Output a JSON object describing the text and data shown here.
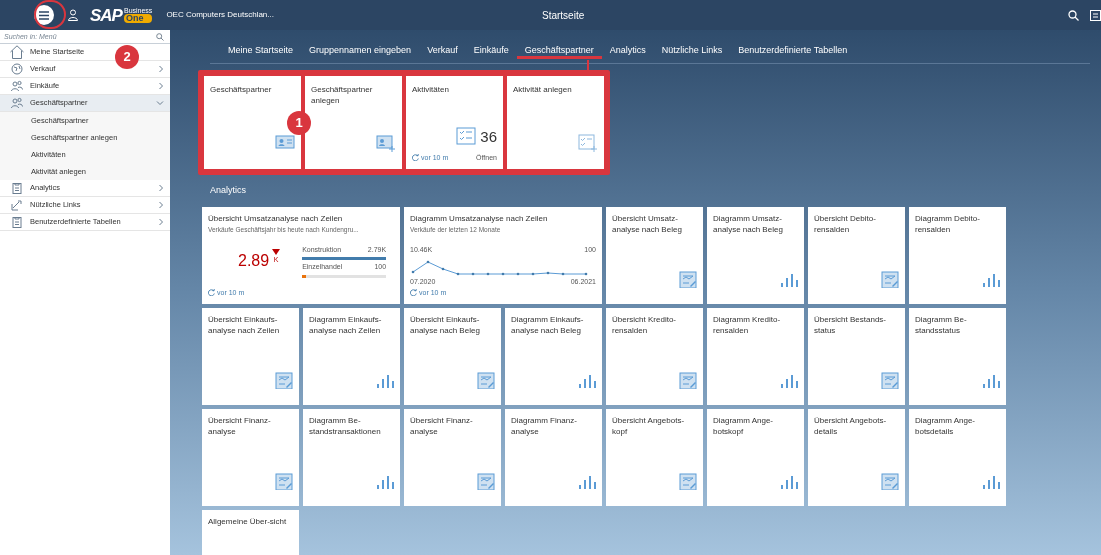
{
  "header": {
    "title": "Startseite",
    "company": "OEC Computers Deutschlan...",
    "logo": "SAP",
    "logo_sub": [
      "Business",
      "One"
    ]
  },
  "sidebar": {
    "search": {
      "placeholder": "Suchen in: Menü"
    },
    "items": [
      {
        "label": "Meine Startseite",
        "kind": "home",
        "expandable": false,
        "expanded": false
      },
      {
        "label": "Verkauf",
        "kind": "sales",
        "expandable": true,
        "expanded": false
      },
      {
        "label": "Einkäufe",
        "kind": "people",
        "expandable": true,
        "expanded": false
      },
      {
        "label": "Geschäftspartner",
        "kind": "people",
        "expandable": true,
        "expanded": true,
        "children": [
          {
            "label": "Geschäftspartner"
          },
          {
            "label": "Geschäftspartner anlegen"
          },
          {
            "label": "Aktivitäten"
          },
          {
            "label": "Aktivität anlegen"
          }
        ]
      },
      {
        "label": "Analytics",
        "kind": "clipboard",
        "expandable": true,
        "expanded": false
      },
      {
        "label": "Nützliche Links",
        "kind": "links",
        "expandable": true,
        "expanded": false
      },
      {
        "label": "Benutzerdefinierte Tabellen",
        "kind": "clipboard",
        "expandable": true,
        "expanded": false
      }
    ]
  },
  "tabs": [
    {
      "label": "Meine Startseite",
      "selected": false
    },
    {
      "label": "Gruppennamen eingeben",
      "selected": false
    },
    {
      "label": "Verkauf",
      "selected": false
    },
    {
      "label": "Einkäufe",
      "selected": false
    },
    {
      "label": "Geschäftspartner",
      "selected": true
    },
    {
      "label": "Analytics",
      "selected": false
    },
    {
      "label": "Nützliche Links",
      "selected": false
    },
    {
      "label": "Benutzerdefinierte Tabellen",
      "selected": false
    }
  ],
  "group_tiles": [
    {
      "kind": "card",
      "title": "Geschäftspartner"
    },
    {
      "kind": "card-add",
      "title": "Geschäftspartner anlegen"
    },
    {
      "kind": "count",
      "title": "Aktivitäten",
      "count": "36",
      "refresh": "vor 10 m",
      "action": "Öffnen"
    },
    {
      "kind": "task-add",
      "title": "Aktivität anlegen"
    }
  ],
  "analytics": {
    "title": "Analytics",
    "tiles": [
      {
        "kind": "kpi",
        "title": "Übersicht Umsatzanalyse nach Zeilen",
        "subtitle": "Verkäufe Geschäftsjahr bis heute nach Kundengru...",
        "value": "2.89",
        "unit": "K",
        "bars": [
          {
            "label": "Konstruktion",
            "value": "2.79K",
            "level": 1.0,
            "color": "#427cac"
          },
          {
            "label": "Einzelhandel",
            "value": "100",
            "level": 0.04,
            "color": "#e9730c"
          }
        ],
        "refresh": "vor 10 m"
      },
      {
        "kind": "trend",
        "title": "Diagramm Umsatzanalyse nach Zeilen",
        "subtitle": "Verkäufe der letzten 12 Monate",
        "max_label": "10.46K",
        "min_label": "100",
        "start_label": "07.2020",
        "end_label": "06.2021",
        "refresh": "vor 10 m"
      },
      {
        "kind": "report",
        "title": "Übersicht Umsatz-analyse nach Beleg"
      },
      {
        "kind": "chart",
        "title": "Diagramm Umsatz-analyse nach Beleg"
      },
      {
        "kind": "report",
        "title": "Übersicht Debito-rensalden"
      },
      {
        "kind": "chart",
        "title": "Diagramm Debito-rensalden"
      },
      {
        "kind": "report",
        "title": "Übersicht Einkaufs-analyse nach Zeilen"
      },
      {
        "kind": "chart",
        "title": "Diagramm Einkaufs-analyse nach Zeilen"
      },
      {
        "kind": "report",
        "title": "Übersicht Einkaufs-analyse nach Beleg"
      },
      {
        "kind": "chart",
        "title": "Diagramm Einkaufs-analyse nach Beleg"
      },
      {
        "kind": "report",
        "title": "Übersicht Kredito-rensalden"
      },
      {
        "kind": "chart",
        "title": "Diagramm Kredito-rensalden"
      },
      {
        "kind": "report",
        "title": "Übersicht Bestands-status"
      },
      {
        "kind": "chart",
        "title": "Diagramm Be-standsstatus"
      },
      {
        "kind": "report",
        "title": "Übersicht Finanz-analyse"
      },
      {
        "kind": "chart",
        "title": "Diagramm Be-standstransaktionen"
      },
      {
        "kind": "report",
        "title": "Übersicht Finanz-analyse"
      },
      {
        "kind": "chart",
        "title": "Diagramm Finanz-analyse"
      },
      {
        "kind": "report",
        "title": "Übersicht Angebots-kopf"
      },
      {
        "kind": "chart",
        "title": "Diagramm Ange-botskopf"
      },
      {
        "kind": "report",
        "title": "Übersicht Angebots-details"
      },
      {
        "kind": "chart",
        "title": "Diagramm Ange-botsdetails"
      },
      {
        "kind": "plain",
        "title": "Allgemeine Über-sicht"
      }
    ]
  },
  "callouts": [
    {
      "label": "1"
    },
    {
      "label": "2"
    }
  ]
}
